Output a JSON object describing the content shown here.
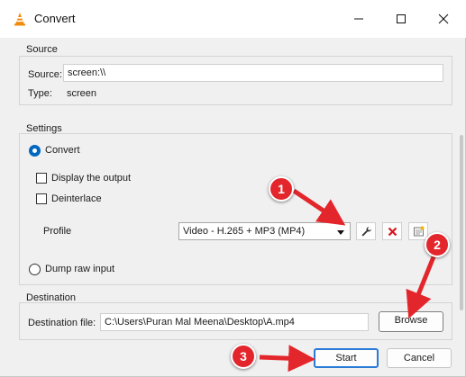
{
  "window": {
    "title": "Convert",
    "icon": "vlc-cone-icon",
    "controls": [
      "minimize-icon",
      "maximize-icon",
      "close-icon"
    ]
  },
  "source": {
    "group_title": "Source",
    "source_label": "Source:",
    "source_value": "screen:\\\\",
    "type_label": "Type:",
    "type_value": "screen"
  },
  "settings": {
    "group_title": "Settings",
    "convert_label": "Convert",
    "convert_checked": true,
    "display_output_label": "Display the output",
    "display_output_checked": false,
    "deinterlace_label": "Deinterlace",
    "deinterlace_checked": false,
    "profile_label": "Profile",
    "profile_value": "Video - H.265 + MP3 (MP4)",
    "profile_buttons": [
      "wrench-icon",
      "red-x-icon",
      "new-profile-icon"
    ],
    "dump_raw_label": "Dump raw input",
    "dump_raw_checked": false
  },
  "destination": {
    "group_title": "Destination",
    "file_label": "Destination file:",
    "file_value": "C:\\Users\\Puran Mal Meena\\Desktop\\A.mp4",
    "browse_label": "Browse"
  },
  "footer": {
    "start_label": "Start",
    "cancel_label": "Cancel"
  },
  "annotations": {
    "badges": [
      "1",
      "2",
      "3"
    ],
    "color": "#e3262c"
  },
  "colors": {
    "accent": "#0067c0",
    "annotation_red": "#e3262c",
    "button_focus": "#2a7ad8"
  }
}
